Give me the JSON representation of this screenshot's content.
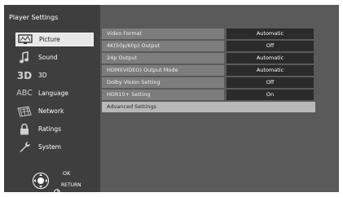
{
  "window": {
    "title": "Player Settings"
  },
  "sidebar": {
    "items": [
      {
        "label": "Picture",
        "icon": "picture-icon",
        "active": true
      },
      {
        "label": "Sound",
        "icon": "music-note-icon",
        "active": false
      },
      {
        "label": "3D",
        "icon": "3d-icon",
        "active": false
      },
      {
        "label": "Language",
        "icon": "abc-icon",
        "active": false
      },
      {
        "label": "Network",
        "icon": "network-icon",
        "active": false
      },
      {
        "label": "Ratings",
        "icon": "lock-icon",
        "active": false
      },
      {
        "label": "System",
        "icon": "wrench-icon",
        "active": false
      }
    ]
  },
  "settings": {
    "rows": [
      {
        "label": "Video Format",
        "value": "Automatic"
      },
      {
        "label": "4K(50p/60p) Output",
        "value": "Off"
      },
      {
        "label": "24p Output",
        "value": "Automatic"
      },
      {
        "label": "HDMI(VIDEO) Output Mode",
        "value": "Automatic"
      },
      {
        "label": "Dolby Vision Setting",
        "value": "Off"
      },
      {
        "label": "HDR10+ Setting",
        "value": "On"
      }
    ],
    "advanced_label": "Advanced Settings"
  },
  "footer": {
    "ok_label": "OK",
    "return_label": "RETURN"
  },
  "colors": {
    "sidebar_bg": "#3e3e3e",
    "panel_bg": "#5a5a5a",
    "active_bg": "#e8e8e8"
  }
}
